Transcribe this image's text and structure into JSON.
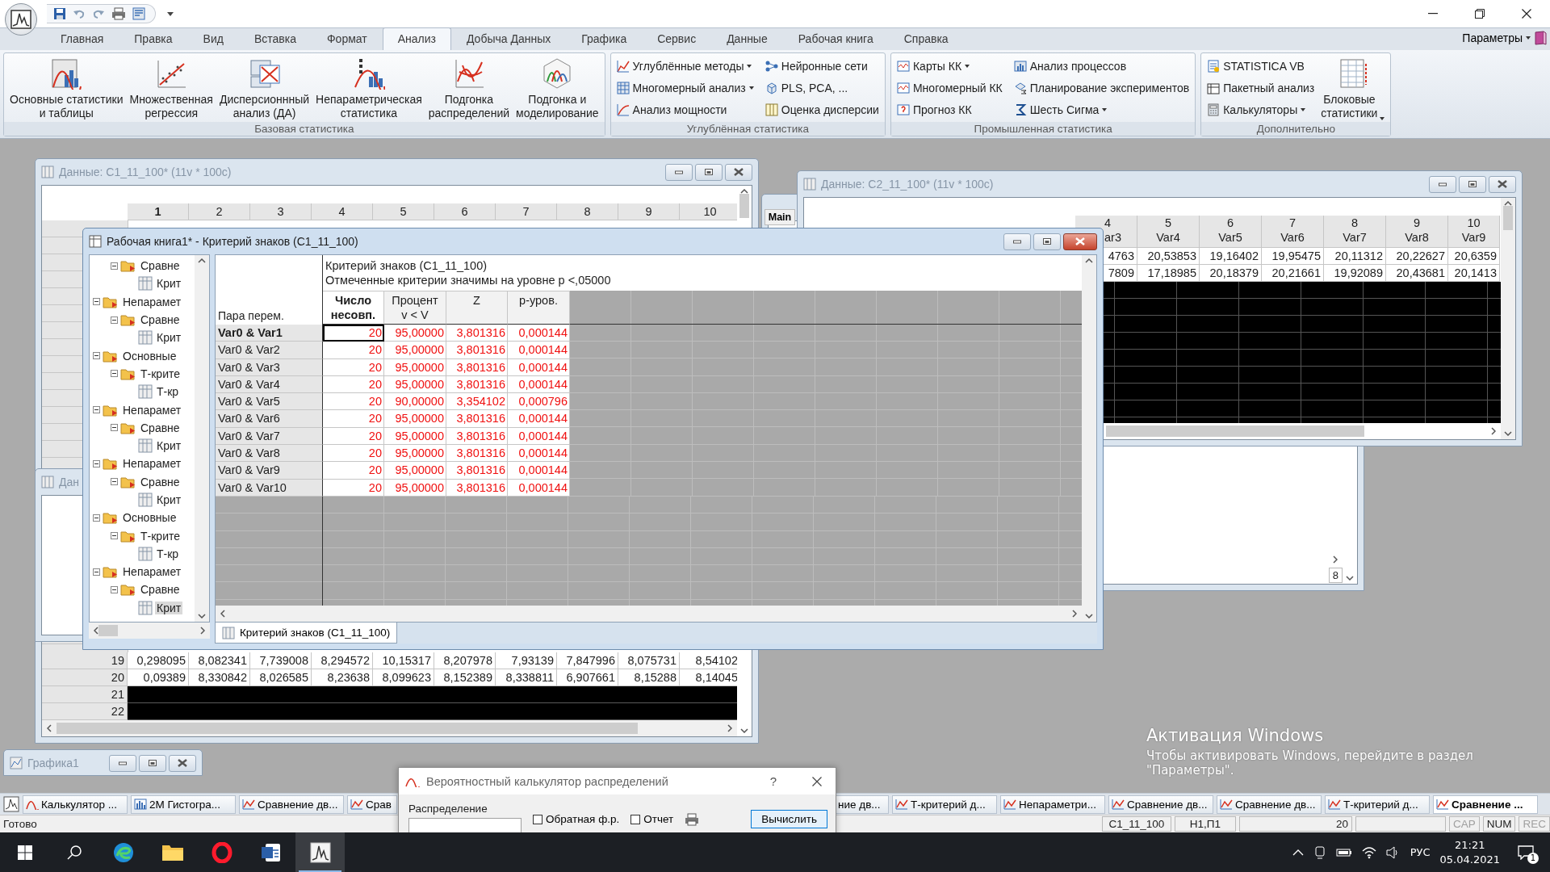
{
  "ribbon_tabs": [
    {
      "label": "Главная",
      "selected": false
    },
    {
      "label": "Правка",
      "selected": false
    },
    {
      "label": "Вид",
      "selected": false
    },
    {
      "label": "Вставка",
      "selected": false
    },
    {
      "label": "Формат",
      "selected": false
    },
    {
      "label": "Анализ",
      "selected": true
    },
    {
      "label": "Добыча Данных",
      "selected": false
    },
    {
      "label": "Графика",
      "selected": false
    },
    {
      "label": "Сервис",
      "selected": false
    },
    {
      "label": "Данные",
      "selected": false
    },
    {
      "label": "Рабочая книга",
      "selected": false
    },
    {
      "label": "Справка",
      "selected": false
    }
  ],
  "params_menu": {
    "label": "Параметры"
  },
  "ribbon_groups": [
    {
      "title": "Базовая статистика",
      "buttons": [
        {
          "label": "Основные статистики\nи таблицы",
          "kind": "large",
          "dropdown": false
        },
        {
          "label": "Множественная\nрегрессия",
          "kind": "large",
          "dropdown": false
        },
        {
          "label": "Дисперсионнный\nанализ (ДА)",
          "kind": "large",
          "dropdown": false
        },
        {
          "label": "Непараметрическая\nстатистика",
          "kind": "large",
          "dropdown": false
        },
        {
          "label": "Подгонка\nраспределений",
          "kind": "large",
          "dropdown": false
        },
        {
          "label": "Подгонка и\nмоделирование",
          "kind": "large",
          "dropdown": false
        }
      ]
    },
    {
      "title": "Углублённая статистика",
      "buttons": [
        {
          "label": "Углублённые методы",
          "kind": "small",
          "dropdown": true
        },
        {
          "label": "Многомерный анализ",
          "kind": "small",
          "dropdown": true
        },
        {
          "label": "Анализ мощности",
          "kind": "small",
          "dropdown": false
        },
        {
          "label": "Нейронные сети",
          "kind": "small",
          "dropdown": false
        },
        {
          "label": "PLS, PCA, ...",
          "kind": "small",
          "dropdown": false
        },
        {
          "label": "Оценка дисперсии",
          "kind": "small",
          "dropdown": false
        }
      ]
    },
    {
      "title": "Промышленная статистика",
      "buttons": [
        {
          "label": "Карты КК",
          "kind": "small",
          "dropdown": true
        },
        {
          "label": "Многомерный КК",
          "kind": "small",
          "dropdown": false
        },
        {
          "label": "Прогноз КК",
          "kind": "small",
          "dropdown": false
        },
        {
          "label": "Анализ процессов",
          "kind": "small",
          "dropdown": false
        },
        {
          "label": "Планирование экспериментов",
          "kind": "small",
          "dropdown": false
        },
        {
          "label": "Шесть Сигма",
          "kind": "small",
          "dropdown": true
        }
      ]
    },
    {
      "title": "Дополнительно",
      "buttons": [
        {
          "label": "STATISTICA VB",
          "kind": "small",
          "dropdown": false
        },
        {
          "label": "Пакетный анализ",
          "kind": "small",
          "dropdown": false
        },
        {
          "label": "Калькуляторы",
          "kind": "small",
          "dropdown": true
        },
        {
          "label": "Блоковые\nстатистики",
          "kind": "large",
          "dropdown": true
        }
      ]
    }
  ],
  "data_window_1": {
    "title": "Данные: C1_11_100* (11v * 100c)",
    "column_headers": [
      {
        "label": "1",
        "selected": true
      },
      {
        "label": "2",
        "selected": false
      },
      {
        "label": "3",
        "selected": false
      },
      {
        "label": "4",
        "selected": false
      },
      {
        "label": "5",
        "selected": false
      },
      {
        "label": "6",
        "selected": false
      },
      {
        "label": "7",
        "selected": false
      },
      {
        "label": "8",
        "selected": false
      },
      {
        "label": "9",
        "selected": false
      },
      {
        "label": "10",
        "selected": false
      }
    ],
    "rows": [
      {
        "number": "19",
        "cells": [
          "0,298095",
          "8,082341",
          "7,739008",
          "8,294572",
          "10,15317",
          "8,207978",
          "7,93139",
          "7,847996",
          "8,075731",
          "8,54102"
        ]
      },
      {
        "number": "20",
        "cells": [
          "0,09389",
          "8,330842",
          "8,026585",
          "8,23638",
          "8,099623",
          "8,152389",
          "8,338811",
          "6,907661",
          "8,15288",
          "8,14045"
        ]
      }
    ],
    "empty_rows": [
      "21",
      "22"
    ]
  },
  "report_window": {
    "tab": "Main",
    "field": "8"
  },
  "data_window_2": {
    "title": "Данные: C2_11_100* (11v * 100c)",
    "columns": [
      {
        "number": "4",
        "name": "ar3"
      },
      {
        "number": "5",
        "name": "Var4"
      },
      {
        "number": "6",
        "name": "Var5"
      },
      {
        "number": "7",
        "name": "Var6"
      },
      {
        "number": "8",
        "name": "Var7"
      },
      {
        "number": "9",
        "name": "Var8"
      },
      {
        "number": "10",
        "name": "Var9"
      }
    ],
    "rows": [
      [
        "4763",
        "20,53853",
        "19,16402",
        "19,95475",
        "20,11312",
        "20,22627",
        "20,6359"
      ],
      [
        "7809",
        "17,18985",
        "20,18379",
        "20,21661",
        "19,92089",
        "20,43681",
        "20,1413"
      ]
    ]
  },
  "data_window_3": {
    "title": "Дан"
  },
  "workbook": {
    "title": "Рабочая книга1* - Критерий знаков (C1_11_100)",
    "tree": [
      {
        "children": [
          {
            "label": "Сравне",
            "selected": false,
            "expanded": true,
            "children": [
              {
                "label": "Крит",
                "selected": false
              }
            ]
          }
        ]
      },
      {
        "label": "Непарамет",
        "selected": false,
        "expanded": true,
        "children": [
          {
            "label": "Сравне",
            "selected": false,
            "expanded": true,
            "children": [
              {
                "label": "Крит",
                "selected": false
              }
            ]
          }
        ]
      },
      {
        "label": "Основные",
        "selected": false,
        "expanded": true,
        "children": [
          {
            "label": "Т-крите",
            "selected": false,
            "expanded": true,
            "children": [
              {
                "label": "Т-кр",
                "selected": false
              }
            ]
          }
        ]
      },
      {
        "label": "Непарамет",
        "selected": false,
        "expanded": true,
        "children": [
          {
            "label": "Сравне",
            "selected": false,
            "expanded": true,
            "children": [
              {
                "label": "Крит",
                "selected": false
              }
            ]
          }
        ]
      },
      {
        "label": "Непарамет",
        "selected": false,
        "expanded": true,
        "children": [
          {
            "label": "Сравне",
            "selected": false,
            "expanded": true,
            "children": [
              {
                "label": "Крит",
                "selected": false
              }
            ]
          }
        ]
      },
      {
        "label": "Основные",
        "selected": false,
        "expanded": true,
        "children": [
          {
            "label": "Т-крите",
            "selected": false,
            "expanded": true,
            "children": [
              {
                "label": "Т-кр",
                "selected": false
              }
            ]
          }
        ]
      },
      {
        "label": "Непарамет",
        "selected": false,
        "expanded": true,
        "children": [
          {
            "label": "Сравне",
            "selected": false,
            "expanded": true,
            "children": [
              {
                "label": "Крит",
                "selected": true
              }
            ]
          }
        ]
      }
    ],
    "title_lines": [
      "Критерий знаков (C1_11_100)",
      "Отмеченные критерии значимы на уровне p <,05000"
    ],
    "row_header": "Пара перем.",
    "columns": [
      {
        "label": "Число\nнесовп.",
        "selected": true
      },
      {
        "label": "Процент\nv < V",
        "selected": false
      },
      {
        "label": "Z",
        "selected": false
      },
      {
        "label": "p-уров.",
        "selected": false
      }
    ],
    "rows": [
      {
        "label": "Var0 & Var1",
        "selected": true,
        "significant": true,
        "cells": [
          "20",
          "95,00000",
          "3,801316",
          "0,000144"
        ]
      },
      {
        "label": "Var0 & Var2",
        "selected": false,
        "significant": true,
        "cells": [
          "20",
          "95,00000",
          "3,801316",
          "0,000144"
        ]
      },
      {
        "label": "Var0 & Var3",
        "selected": false,
        "significant": true,
        "cells": [
          "20",
          "95,00000",
          "3,801316",
          "0,000144"
        ]
      },
      {
        "label": "Var0 & Var4",
        "selected": false,
        "significant": true,
        "cells": [
          "20",
          "95,00000",
          "3,801316",
          "0,000144"
        ]
      },
      {
        "label": "Var0 & Var5",
        "selected": false,
        "significant": true,
        "cells": [
          "20",
          "90,00000",
          "3,354102",
          "0,000796"
        ]
      },
      {
        "label": "Var0 & Var6",
        "selected": false,
        "significant": true,
        "cells": [
          "20",
          "95,00000",
          "3,801316",
          "0,000144"
        ]
      },
      {
        "label": "Var0 & Var7",
        "selected": false,
        "significant": true,
        "cells": [
          "20",
          "95,00000",
          "3,801316",
          "0,000144"
        ]
      },
      {
        "label": "Var0 & Var8",
        "selected": false,
        "significant": true,
        "cells": [
          "20",
          "95,00000",
          "3,801316",
          "0,000144"
        ]
      },
      {
        "label": "Var0 & Var9",
        "selected": false,
        "significant": true,
        "cells": [
          "20",
          "95,00000",
          "3,801316",
          "0,000144"
        ]
      },
      {
        "label": "Var0 & Var10",
        "selected": false,
        "significant": true,
        "cells": [
          "20",
          "95,00000",
          "3,801316",
          "0,000144"
        ]
      }
    ],
    "sheet_tab": "Критерий знаков (C1_11_100)"
  },
  "graph_window": {
    "title": "Графика1"
  },
  "activation": {
    "title": "Активация Windows",
    "lines": [
      "Чтобы активировать Windows, перейдите в раздел",
      "\"Параметры\"."
    ]
  },
  "document_tabs": [
    {
      "label": "Калькулятор ...",
      "kind": "curve",
      "selected": false
    },
    {
      "label": "2М Гистогра...",
      "kind": "histogram",
      "selected": false
    },
    {
      "label": "Сравнение дв...",
      "kind": "chart",
      "selected": false
    },
    {
      "label": "Срав",
      "kind": "chart",
      "selected": false
    },
    {
      "label": "ние дв...",
      "kind": "text",
      "selected": false
    },
    {
      "label": "Т-критерий д...",
      "kind": "chart",
      "selected": false
    },
    {
      "label": "Непараметри...",
      "kind": "chart",
      "selected": false
    },
    {
      "label": "Сравнение дв...",
      "kind": "chart",
      "selected": false
    },
    {
      "label": "Сравнение дв...",
      "kind": "chart",
      "selected": false
    },
    {
      "label": "Т-критерий д...",
      "kind": "chart",
      "selected": false
    },
    {
      "label": "Сравнение ...",
      "kind": "chart",
      "selected": true
    }
  ],
  "status_bar": {
    "text": "Готово",
    "fields": [
      "C1_11_100",
      "Н1,П1",
      "20"
    ],
    "indicators": [
      {
        "label": "CAP",
        "on": false
      },
      {
        "label": "NUM",
        "on": true
      },
      {
        "label": "REC",
        "on": false
      }
    ]
  },
  "dialog": {
    "title": "Вероятностный калькулятор распределений",
    "help": "?",
    "distribution_label": "Распределение",
    "options": [
      {
        "label": "Обратная ф.р.",
        "checked": false
      },
      {
        "label": "Отчет",
        "checked": false
      }
    ],
    "compute_button": "Вычислить"
  },
  "os_taskbar": {
    "apps": [
      {
        "active": false
      },
      {
        "active": false
      },
      {
        "active": false
      },
      {
        "active": false
      },
      {
        "active": true
      }
    ],
    "language": "РУС",
    "time": "21:21",
    "date": "05.04.2021",
    "notification_count": "1"
  }
}
